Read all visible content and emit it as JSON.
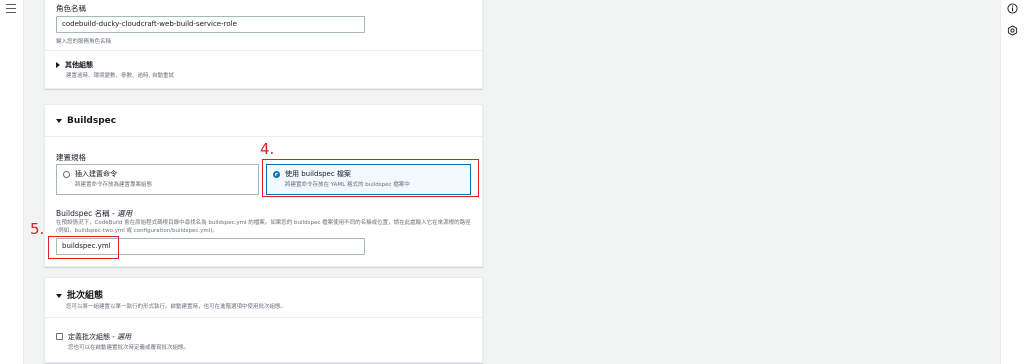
{
  "role": {
    "label": "角色名稱",
    "value": "codebuild-ducky-cloudcraft-web-build-service-role",
    "hint": "鍵入您的服務角色名稱"
  },
  "additional": {
    "title": "其他組態",
    "hint": "建置逾時、環境變數、參數、逾時, 自動重試"
  },
  "buildspec": {
    "title": "Buildspec",
    "spec_label": "建置規格",
    "option_insert_title": "插入建置命令",
    "option_insert_desc": "將建置命令存放為建置專案組態",
    "option_file_title": "使用 buildspec 檔案",
    "option_file_desc": "將建置命令存放在 YAML 格式的 buildspec 檔案中",
    "name_label": "Buildspec 名稱",
    "name_optional": "- 選用",
    "name_hint": "在預設情況下，CodeBuild 會在原始程式碼根目錄中尋找名為 buildspec.yml 的檔案。如果您的 buildspec 檔案使用不同的名稱或位置，請在此處輸入它在來源根的路徑 (例如，buildspec-two.yml 或 configuration/buildspec.yml)。",
    "name_value": "buildspec.yml"
  },
  "batch": {
    "title": "批次組態",
    "desc": "您可以將一組建置以單一執行的形式執行。啟動建置時，也可在進階選項中使用批次組態。",
    "checkbox_label": "定義批次組態",
    "checkbox_optional": "- 選用",
    "checkbox_hint": "您也可以在啟動建置批次時定義或覆寫批次組態。"
  },
  "annotations": {
    "step4": "4.",
    "step5": "5."
  },
  "colors": {
    "accent": "#0073bb",
    "annotation": "#e02020"
  },
  "icons": {
    "menu": "hamburger-icon",
    "info": "info-icon",
    "settings": "settings-icon"
  }
}
